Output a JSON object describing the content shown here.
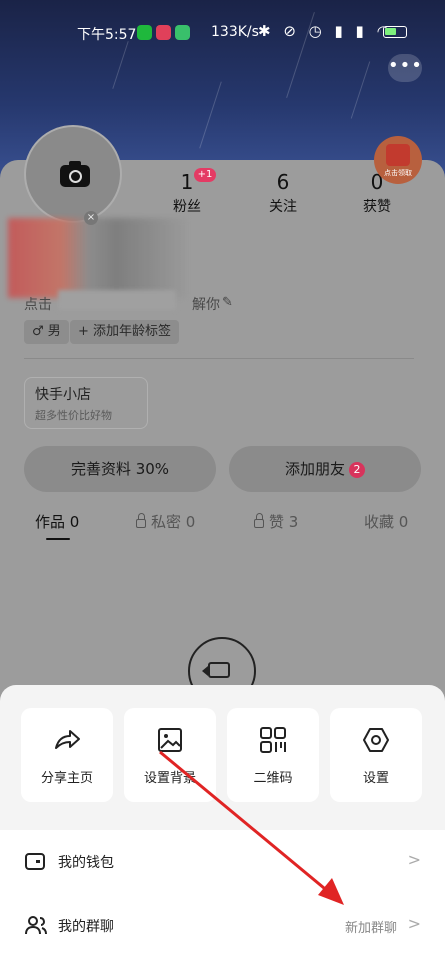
{
  "status_bar": {
    "time": "下午5:57",
    "net_speed": "133K/s",
    "app_icons": [
      "wechat-icon",
      "video-app-icon",
      "android-app-icon"
    ],
    "right_icons": [
      "bluetooth-icon",
      "mute-icon",
      "alarm-icon",
      "signal-icon",
      "signal-icon",
      "wifi-icon",
      "battery-icon"
    ]
  },
  "header": {
    "more_label": "•••"
  },
  "stats": {
    "fans": {
      "value": "1",
      "label": "粉丝",
      "badge": "+1"
    },
    "following": {
      "value": "6",
      "label": "关注"
    },
    "likes": {
      "value": "0",
      "label": "获赞"
    }
  },
  "red_packet": {
    "label": "点击领取"
  },
  "profile": {
    "intro_prefix": "点击",
    "intro_suffix": "解你",
    "tags": {
      "gender": "♂ 男",
      "age": "+ 添加年龄标签"
    }
  },
  "shop": {
    "title": "快手小店",
    "subtitle": "超多性价比好物"
  },
  "buttons": {
    "complete_profile": "完善资料 30%",
    "add_friends": "添加朋友",
    "add_friends_badge": "2"
  },
  "tabs": [
    {
      "label": "作品 0"
    },
    {
      "label": "私密 0"
    },
    {
      "label": "赞 3"
    },
    {
      "label": "收藏 0"
    }
  ],
  "sheet": {
    "actions": [
      {
        "label": "分享主页",
        "icon": "share-icon"
      },
      {
        "label": "设置背景",
        "icon": "image-icon"
      },
      {
        "label": "二维码",
        "icon": "qrcode-icon"
      },
      {
        "label": "设置",
        "icon": "settings-icon"
      }
    ],
    "menu": [
      {
        "label": "我的钱包",
        "icon": "wallet-icon"
      },
      {
        "label": "我的群聊",
        "icon": "group-icon",
        "right_text": "新加群聊"
      }
    ]
  },
  "colors": {
    "overlay": "#9c9c9c",
    "sheet": "#f4f4f4",
    "accent_red": "#e43b64",
    "arrow": "#e02424"
  }
}
